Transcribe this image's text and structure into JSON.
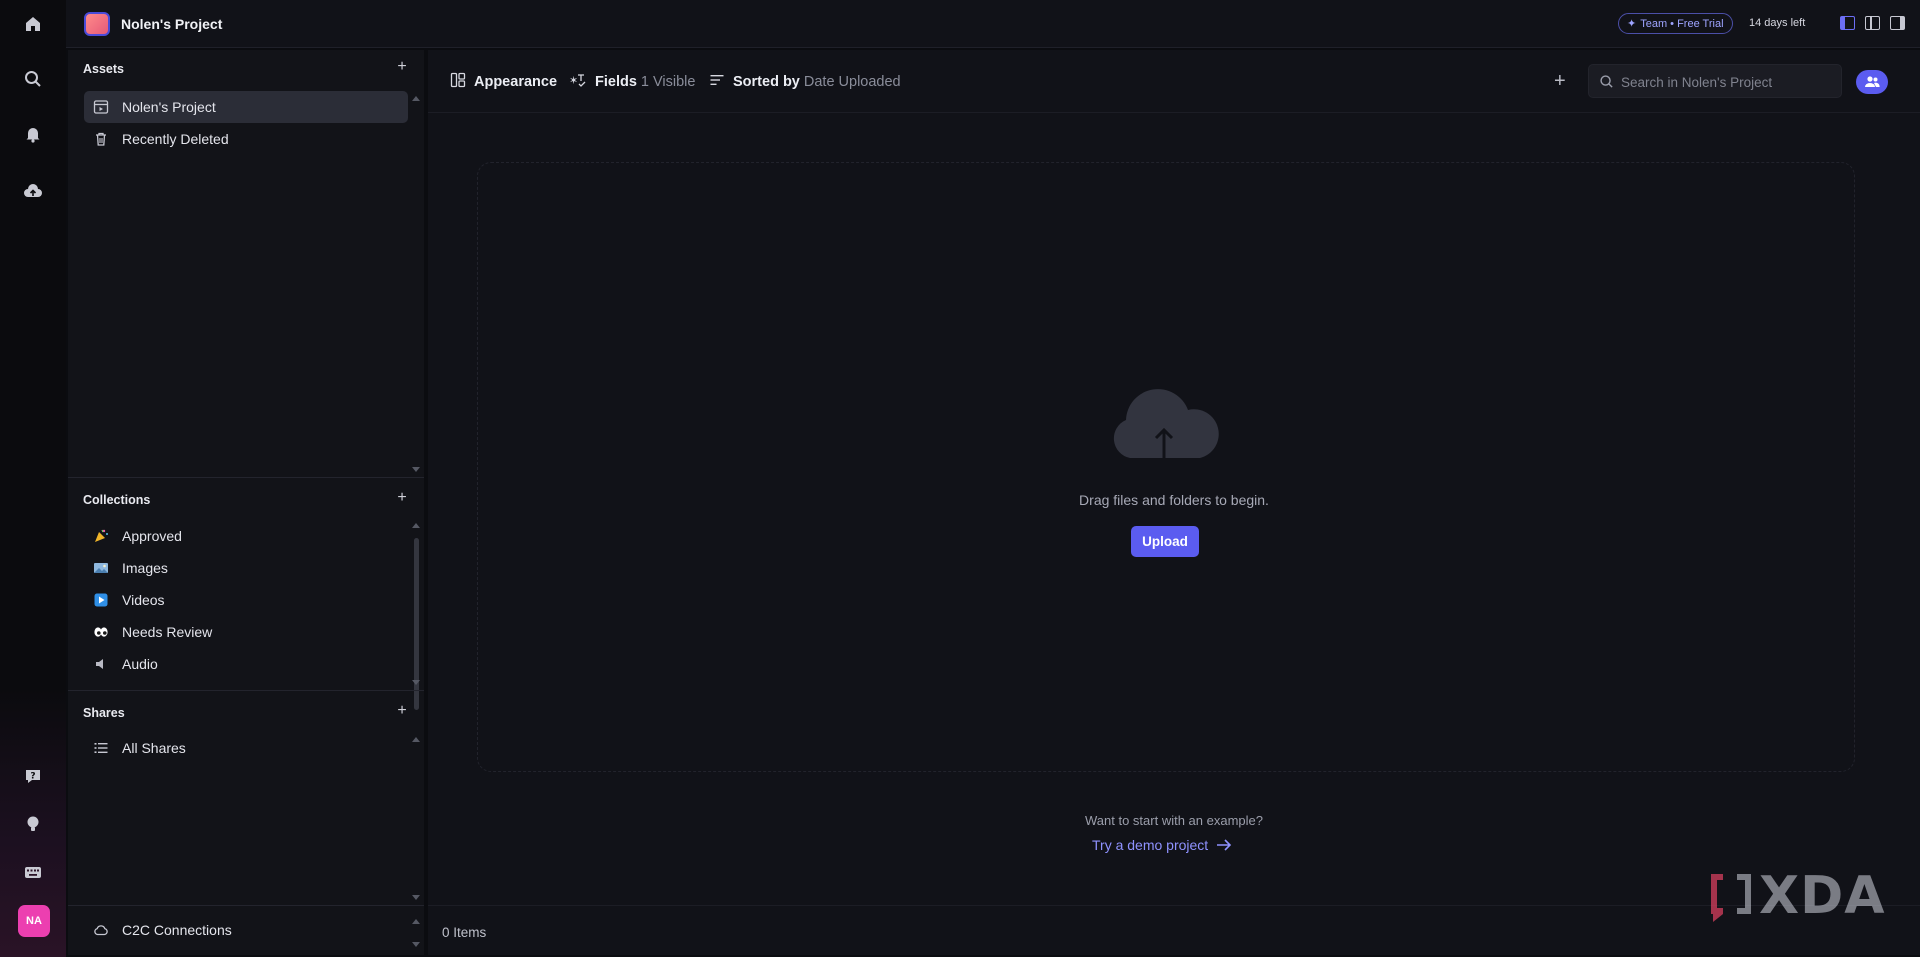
{
  "rail": {
    "icons": [
      "home-icon",
      "search-icon",
      "bell-icon",
      "cloud-upload-icon",
      "help-icon",
      "lightbulb-icon",
      "keyboard-icon"
    ],
    "avatar_initials": "NA"
  },
  "topbar": {
    "project_title": "Nolen's Project",
    "trial_badge": "Team • Free Trial",
    "days_left": "14 days left"
  },
  "sidebar": {
    "assets": {
      "heading": "Assets",
      "items": [
        {
          "label": "Nolen's Project",
          "icon": "project-icon",
          "active": true
        },
        {
          "label": "Recently Deleted",
          "icon": "trash-icon",
          "active": false
        }
      ]
    },
    "collections": {
      "heading": "Collections",
      "items": [
        {
          "label": "Approved",
          "icon": "party-popper-icon"
        },
        {
          "label": "Images",
          "icon": "image-icon"
        },
        {
          "label": "Videos",
          "icon": "play-icon"
        },
        {
          "label": "Needs Review",
          "icon": "eyes-icon"
        },
        {
          "label": "Audio",
          "icon": "speaker-icon"
        }
      ]
    },
    "shares": {
      "heading": "Shares",
      "items": [
        {
          "label": "All Shares",
          "icon": "list-icon"
        }
      ]
    },
    "footer": {
      "label": "C2C Connections",
      "icon": "cloud-icon"
    }
  },
  "toolbar": {
    "appearance_label": "Appearance",
    "fields_label": "Fields",
    "fields_value": "1 Visible",
    "sorted_label": "Sorted by",
    "sorted_value": "Date Uploaded",
    "search_placeholder": "Search in Nolen's Project"
  },
  "main": {
    "drag_text": "Drag files and folders to begin.",
    "upload_label": "Upload",
    "example_prompt": "Want to start with an example?",
    "demo_link": "Try a demo project",
    "items_count": "0 Items"
  },
  "watermark": {
    "text": "XDA"
  },
  "colors": {
    "accent": "#5b5cf0",
    "link": "#8f92ff",
    "background": "#111218",
    "avatar": "#ec3fb0"
  }
}
